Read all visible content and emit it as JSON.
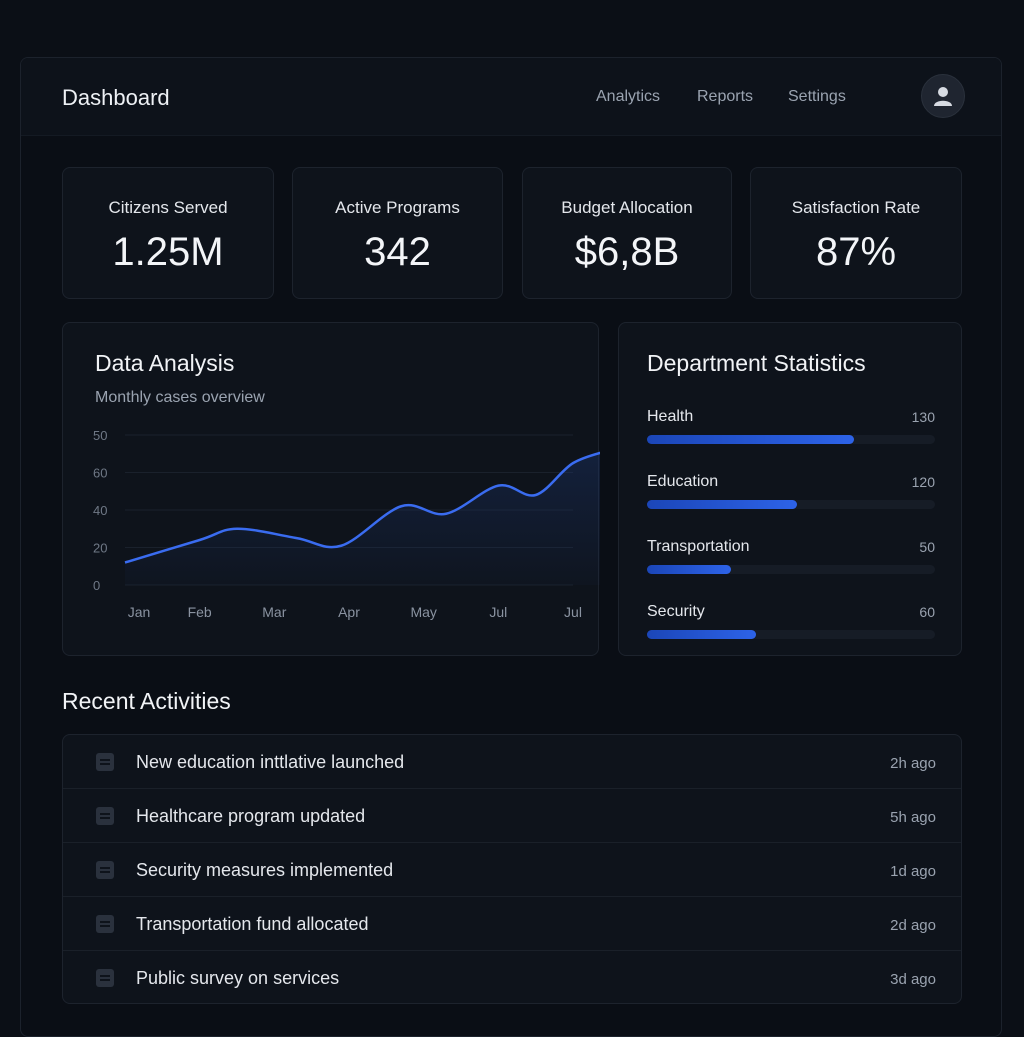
{
  "header": {
    "title": "Dashboard",
    "nav": [
      "Analytics",
      "Reports",
      "Settings"
    ]
  },
  "stats": [
    {
      "label": "Citizens Served",
      "value": "1.25M"
    },
    {
      "label": "Active Programs",
      "value": "342"
    },
    {
      "label": "Budget Allocation",
      "value": "$6,8B"
    },
    {
      "label": "Satisfaction Rate",
      "value": "87%"
    }
  ],
  "analysis": {
    "title": "Data Analysis",
    "subtitle": "Monthly cases overview"
  },
  "departments": {
    "title": "Department Statistics",
    "items": [
      {
        "name": "Health",
        "value": "130",
        "fill": 0.72
      },
      {
        "name": "Education",
        "value": "120",
        "fill": 0.52
      },
      {
        "name": "Transportation",
        "value": "50",
        "fill": 0.29
      },
      {
        "name": "Security",
        "value": "60",
        "fill": 0.38
      }
    ]
  },
  "activities": {
    "title": "Recent Activities",
    "items": [
      {
        "text": "New education inttlative launched",
        "time": "2h ago"
      },
      {
        "text": "Healthcare program updated",
        "time": "5h ago"
      },
      {
        "text": "Security measures implemented",
        "time": "1d ago"
      },
      {
        "text": "Transportation fund allocated",
        "time": "2d ago"
      },
      {
        "text": "Public survey on services",
        "time": "3d ago"
      }
    ]
  },
  "colors": {
    "accent": "#2d63e8",
    "line": "#3a6cf0",
    "background": "#0b0f16",
    "card": "#0e131b"
  },
  "chart_data": {
    "type": "area",
    "categories": [
      "Jan",
      "Feb",
      "Mar",
      "Apr",
      "May",
      "Jul",
      "Jul"
    ],
    "y_ticks": [
      "0",
      "20",
      "40",
      "60",
      "50"
    ],
    "values": [
      12,
      24,
      30,
      25,
      21,
      42,
      38,
      53,
      48,
      65,
      72
    ],
    "x": [
      0,
      1,
      1.5,
      2.3,
      2.9,
      3.7,
      4.3,
      5,
      5.5,
      6,
      6.5
    ],
    "title": "",
    "xlabel": "",
    "ylabel": "",
    "ylim": [
      0,
      80
    ],
    "grid": true
  }
}
